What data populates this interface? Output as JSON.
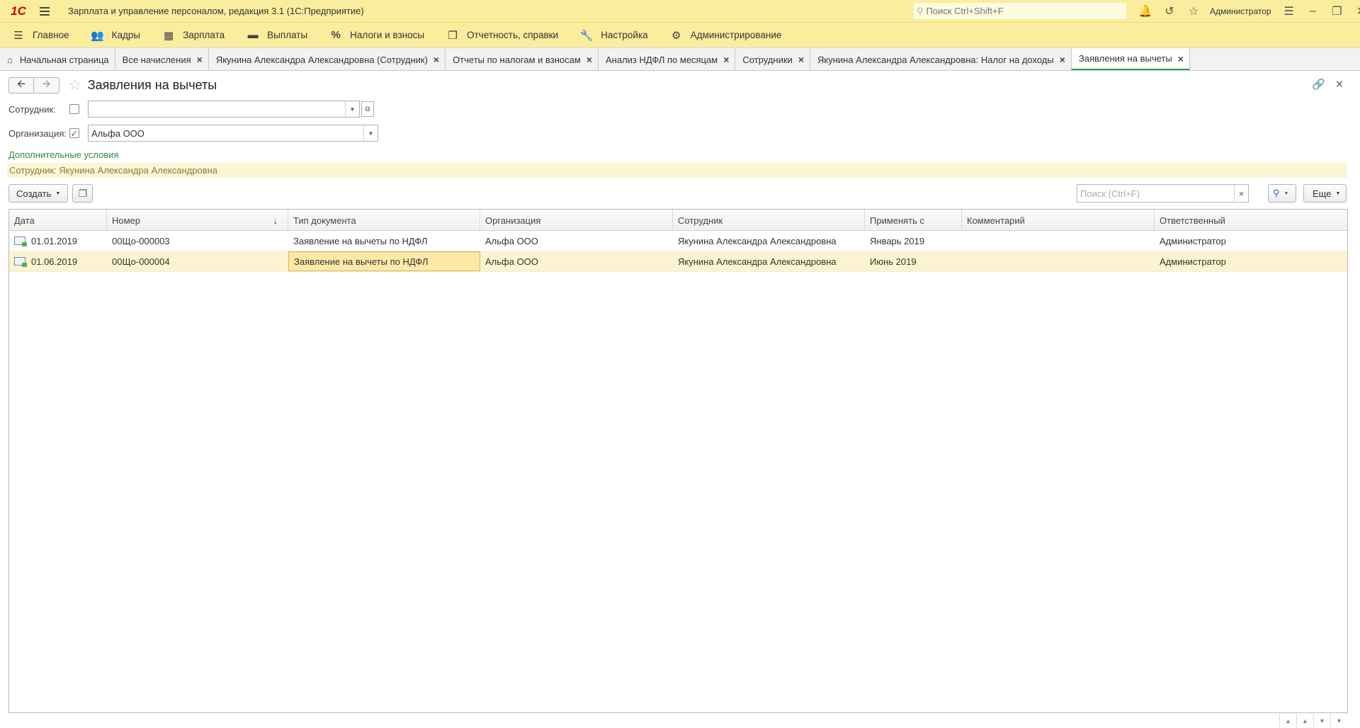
{
  "titlebar": {
    "logo": "1С",
    "title": "Зарплата и управление персоналом, редакция 3.1  (1С:Предприятие)",
    "search_placeholder": "Поиск Ctrl+Shift+F",
    "user": "Администратор"
  },
  "sections": [
    {
      "label": "Главное",
      "icon": "menu-lines-icon"
    },
    {
      "label": "Кадры",
      "icon": "people-icon"
    },
    {
      "label": "Зарплата",
      "icon": "calculator-icon"
    },
    {
      "label": "Выплаты",
      "icon": "wallet-icon"
    },
    {
      "label": "Налоги и взносы",
      "icon": "percent-icon"
    },
    {
      "label": "Отчетность, справки",
      "icon": "reports-icon"
    },
    {
      "label": "Настройка",
      "icon": "wrench-icon"
    },
    {
      "label": "Администрирование",
      "icon": "gear-icon"
    }
  ],
  "tabs": [
    {
      "label": "Начальная страница"
    },
    {
      "label": "Все начисления"
    },
    {
      "label": "Якунина Александра Александровна (Сотрудник)"
    },
    {
      "label": "Отчеты по налогам и взносам"
    },
    {
      "label": "Анализ НДФЛ по месяцам"
    },
    {
      "label": "Сотрудники"
    },
    {
      "label": "Якунина Александра Александровна: Налог на доходы"
    },
    {
      "label": "Заявления на вычеты"
    }
  ],
  "form": {
    "title": "Заявления на вычеты",
    "filters": {
      "employee_label": "Сотрудник:",
      "employee_value": "",
      "employee_checked": false,
      "org_label": "Организация:",
      "org_value": "Альфа ООО",
      "org_checked": true
    },
    "additional_conditions_link": "Дополнительные условия",
    "condition_text": "Сотрудник: Якунина Александра Александровна",
    "create_button": "Создать",
    "search_placeholder": "Поиск (Ctrl+F)",
    "more_button": "Еще"
  },
  "table": {
    "columns": [
      "Дата",
      "Номер",
      "Тип документа",
      "Организация",
      "Сотрудник",
      "Применять с",
      "Комментарий",
      "Ответственный"
    ],
    "rows": [
      {
        "date": "01.01.2019",
        "number": "00Що-000003",
        "doc_type": "Заявление на вычеты по НДФЛ",
        "org": "Альфа ООО",
        "employee": "Якунина Александра Александровна",
        "apply_from": "Январь 2019",
        "comment": "",
        "responsible": "Администратор"
      },
      {
        "date": "01.06.2019",
        "number": "00Що-000004",
        "doc_type": "Заявление на вычеты по НДФЛ",
        "org": "Альфа ООО",
        "employee": "Якунина Александра Александровна",
        "apply_from": "Июнь 2019",
        "comment": "",
        "responsible": "Администратор"
      }
    ]
  }
}
